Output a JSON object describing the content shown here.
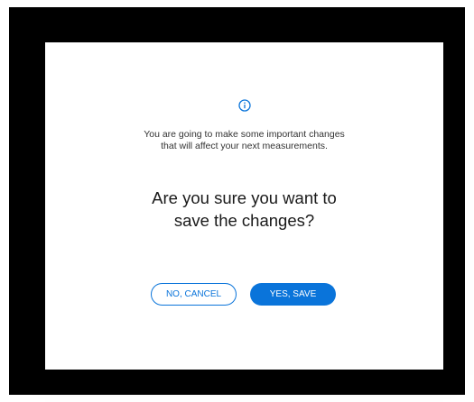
{
  "dialog": {
    "icon": "info-icon",
    "message_line1": "You are going to make some important changes",
    "message_line2": "that will affect your next measurements.",
    "question_line1": "Are you sure you want to",
    "question_line2": "save the changes?",
    "cancel_label": "NO, CANCEL",
    "save_label": "YES, SAVE"
  },
  "colors": {
    "accent": "#0a74da",
    "backdrop": "#000000",
    "dialog_background": "#ffffff"
  }
}
